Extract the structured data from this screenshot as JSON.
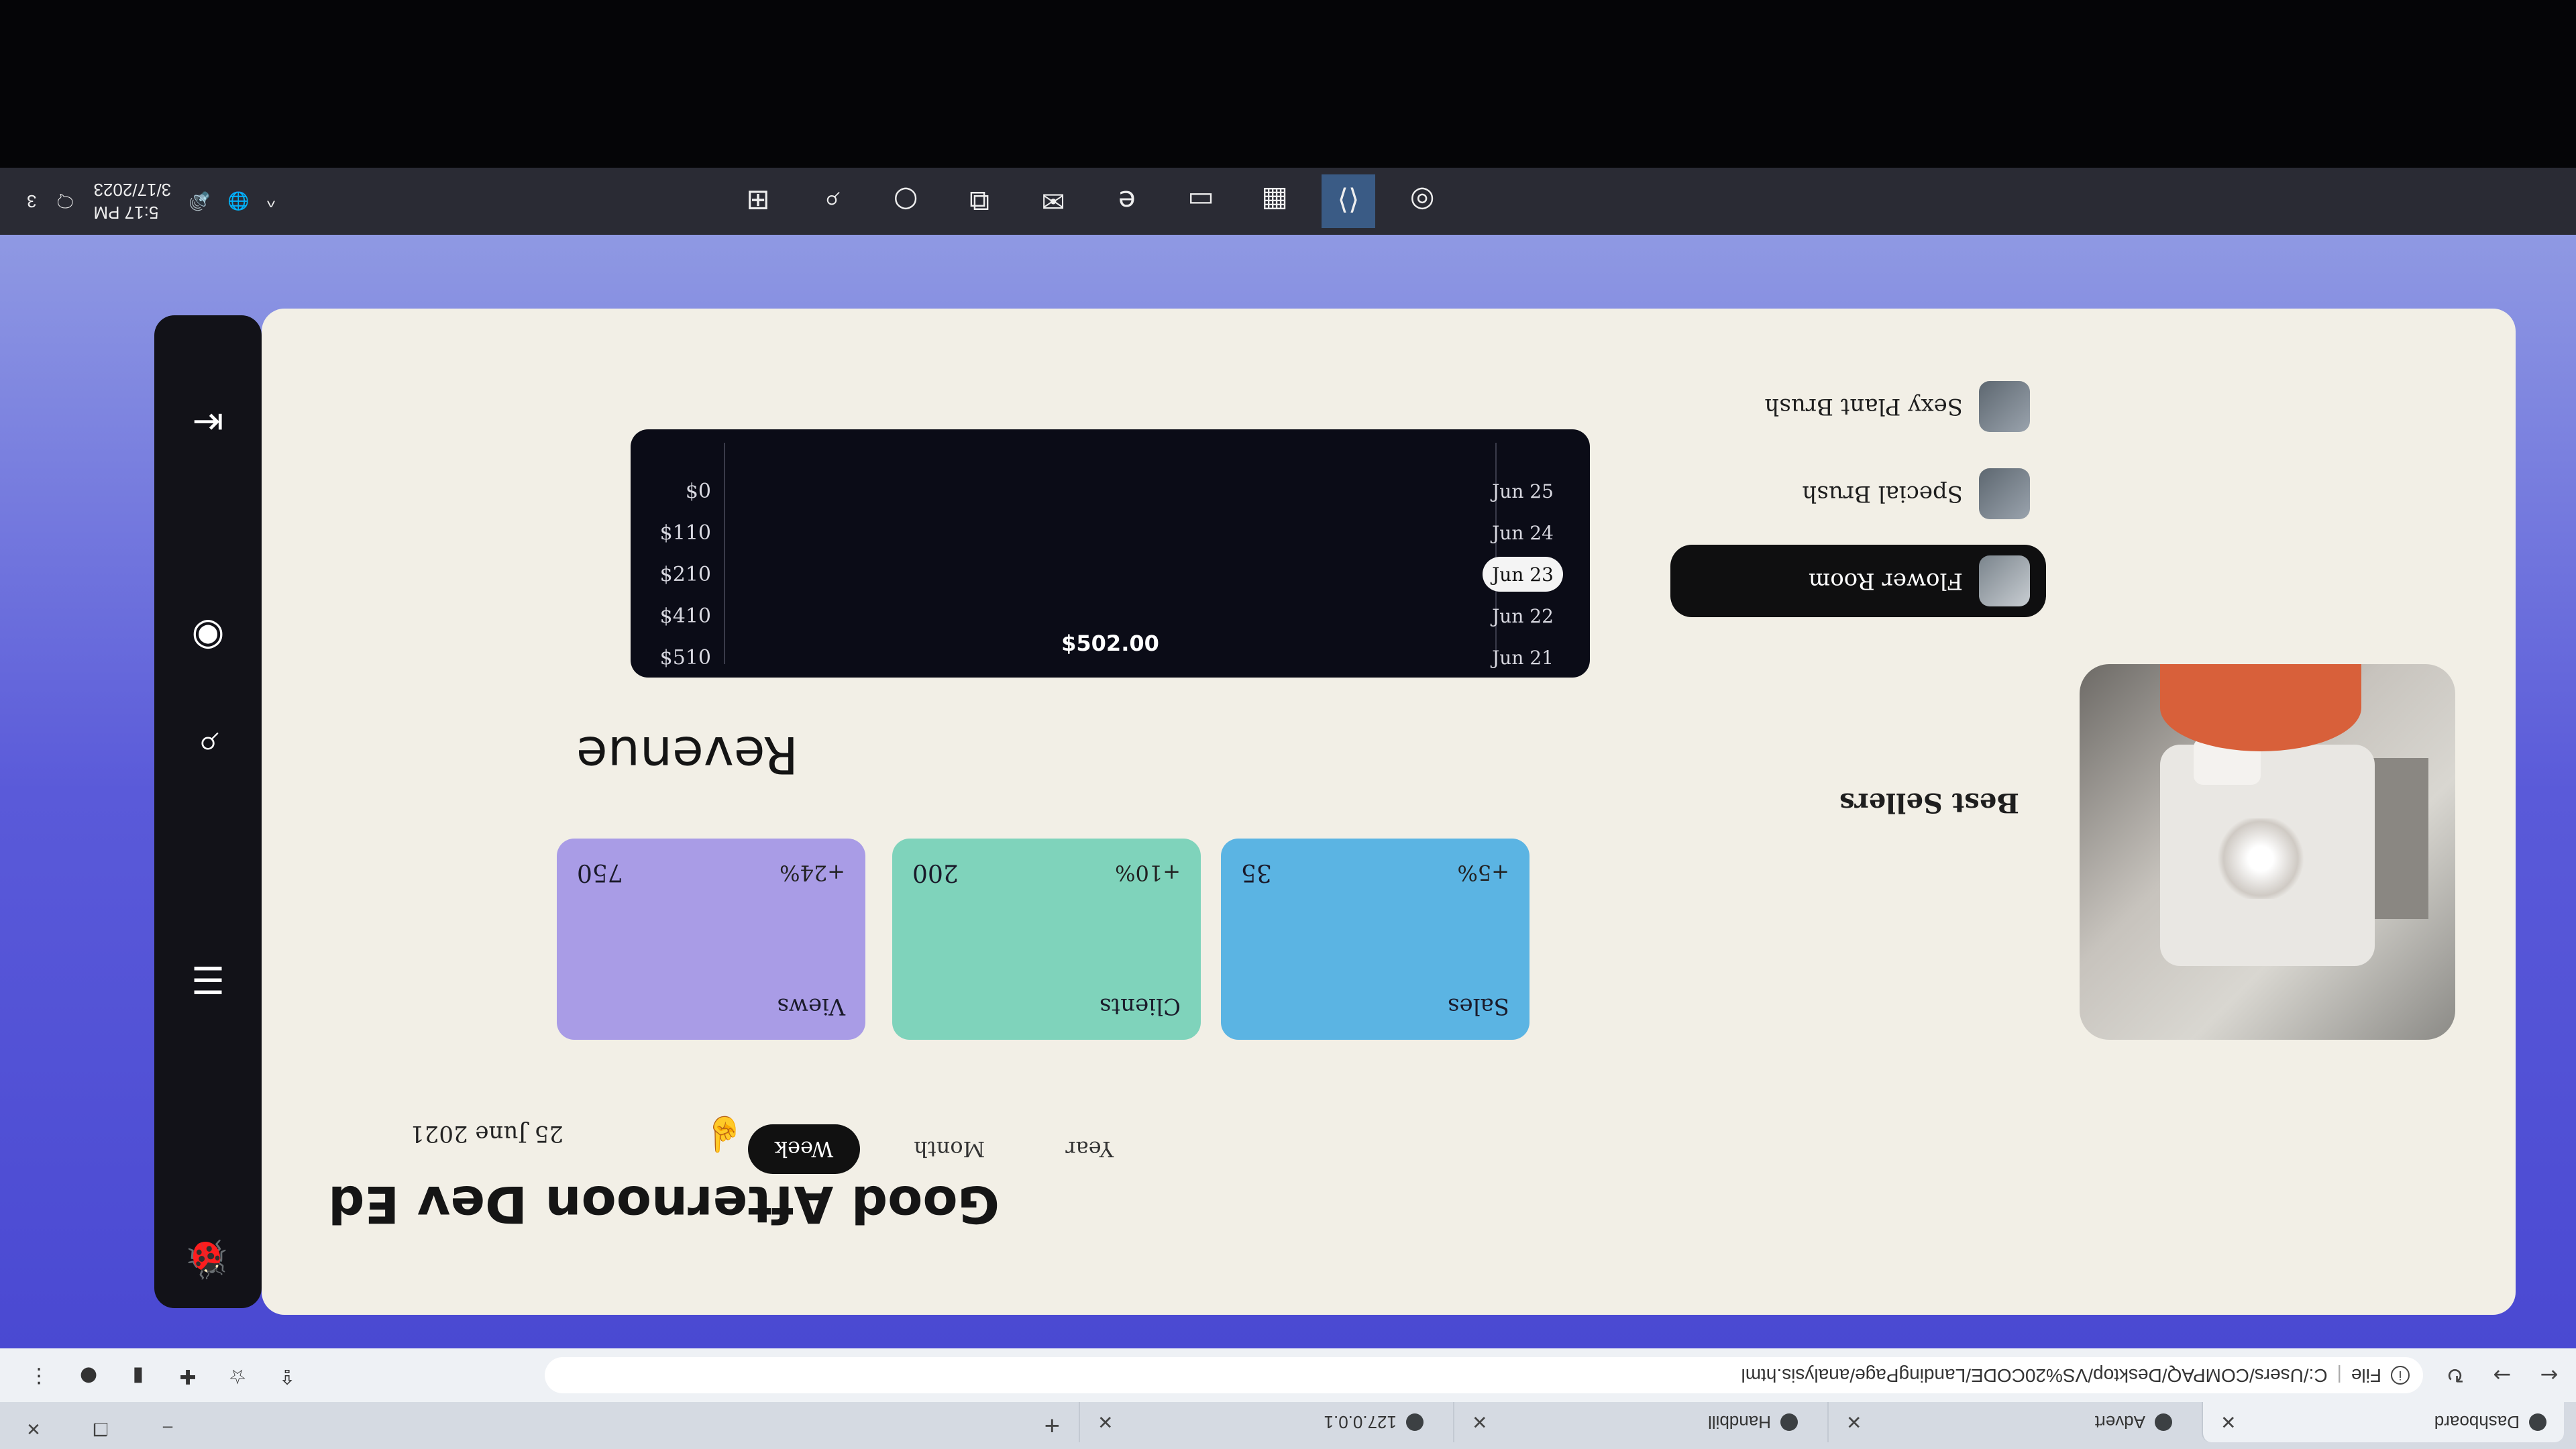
{
  "browser": {
    "tabs": [
      {
        "title": "Dashboard",
        "active": true
      },
      {
        "title": "Advert"
      },
      {
        "title": "Handbill"
      },
      {
        "title": "127.0.0.1"
      }
    ],
    "new_tab": "+",
    "window_controls": {
      "minimize": "–",
      "restore": "❐",
      "close": "✕"
    },
    "url_prefix": "File",
    "url": "C:/Users/COMPAQ/Desktop/VS%20CODE/LandingPage/analysis.html"
  },
  "sidebar": {
    "logo_icon": "bug-logo",
    "icons": [
      "hamburger-icon",
      "search-icon",
      "navigate-icon",
      "collapse-menu-icon"
    ]
  },
  "header": {
    "greeting": "Good Afternoon Dev Ed",
    "date": "25 June 2021",
    "periods": [
      "Week",
      "Month",
      "Year"
    ],
    "active_period": "Week"
  },
  "stats": [
    {
      "label": "Views",
      "value": "750",
      "change": "+24%",
      "color": "#a99ce6"
    },
    {
      "label": "Clients",
      "value": "200",
      "change": "+10%",
      "color": "#7fd3bb"
    },
    {
      "label": "Sales",
      "value": "35",
      "change": "+5%",
      "color": "#5bb4e3"
    }
  ],
  "revenue": {
    "title": "Revenue"
  },
  "best_sellers": {
    "title": "Best Sellers",
    "items": [
      {
        "label": "Flower Room",
        "active": true
      },
      {
        "label": "Special Brush"
      },
      {
        "label": "Sexy Plant Brush"
      }
    ]
  },
  "chart_data": {
    "type": "line",
    "categories": [
      "Jun 21",
      "Jun 22",
      "Jun 23",
      "Jun 24",
      "Jun 25"
    ],
    "y_ticks": [
      "$510",
      "$410",
      "$210",
      "$110",
      "$0"
    ],
    "highlighted_category": "Jun 23",
    "tooltip": "$502.00",
    "ylim": [
      0,
      510
    ],
    "values": [],
    "grid": false
  },
  "taskbar": {
    "apps": [
      "windows-start-icon",
      "search-icon",
      "cortana-icon",
      "task-view-icon",
      "mail-icon",
      "edge-icon",
      "file-explorer-icon",
      "store-icon",
      "vscode-icon",
      "chrome-icon"
    ],
    "time": "5:17 PM",
    "date": "3/17/2023",
    "notifications": "3"
  }
}
